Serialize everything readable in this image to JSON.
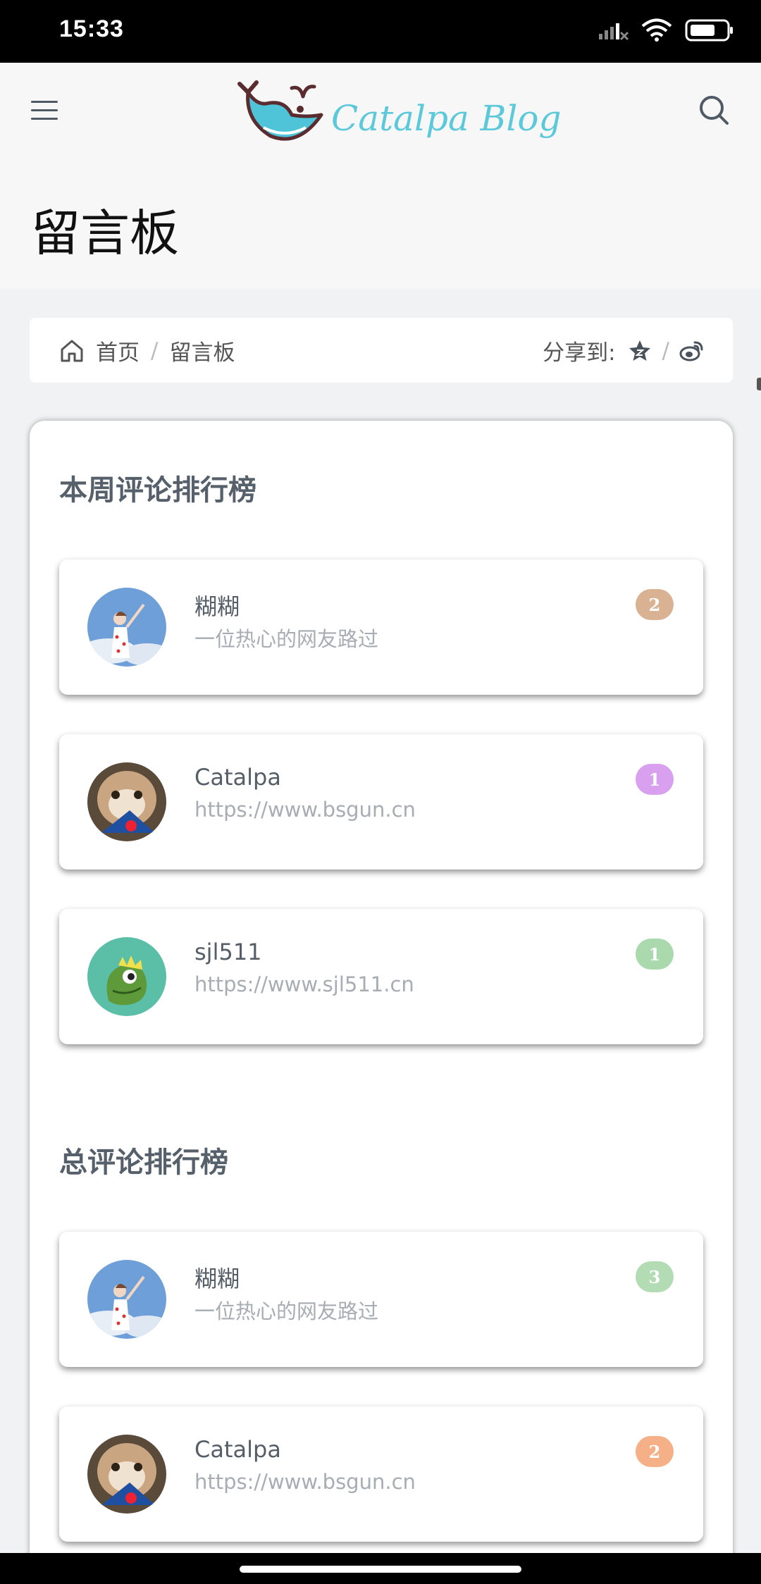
{
  "status_bar": {
    "time": "15:33"
  },
  "header": {
    "logo_text": "Catalpa Blog"
  },
  "page": {
    "title": "留言板"
  },
  "breadcrumb": {
    "home": "首页",
    "separator": "/",
    "current": "留言板",
    "share_label": "分享到:"
  },
  "weekly": {
    "title": "本周评论排行榜",
    "items": [
      {
        "name": "糊糊",
        "desc": "一位热心的网友路过",
        "count": "2",
        "badge_color": "#d8b293",
        "avatar": "girl-avatar"
      },
      {
        "name": "Catalpa",
        "desc": "https://www.bsgun.cn",
        "count": "1",
        "badge_color": "#d9a0f0",
        "avatar": "cat-avatar"
      },
      {
        "name": "sjl511",
        "desc": "https://www.sjl511.cn",
        "count": "1",
        "badge_color": "#a9d9ac",
        "avatar": "dino-avatar"
      }
    ]
  },
  "total": {
    "title": "总评论排行榜",
    "items": [
      {
        "name": "糊糊",
        "desc": "一位热心的网友路过",
        "count": "3",
        "badge_color": "#b3dcb5",
        "avatar": "girl-avatar"
      },
      {
        "name": "Catalpa",
        "desc": "https://www.bsgun.cn",
        "count": "2",
        "badge_color": "#f6b087",
        "avatar": "cat-avatar"
      }
    ]
  },
  "colors": {
    "accent": "#5cc9db",
    "text": "#505a63",
    "muted": "#a7adb3"
  },
  "icons": [
    "menu-icon",
    "whale-logo-icon",
    "search-icon",
    "home-icon",
    "star-icon",
    "weibo-icon"
  ]
}
